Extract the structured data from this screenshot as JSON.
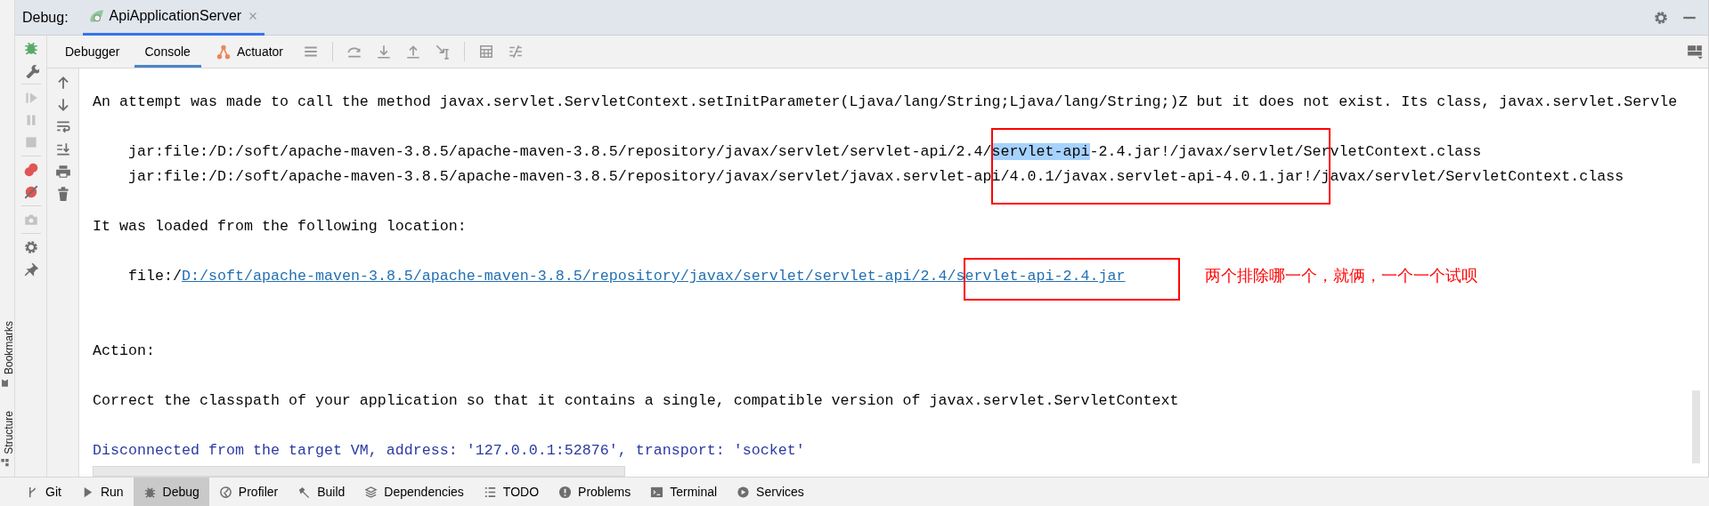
{
  "header": {
    "label": "Debug:",
    "tab": {
      "title": "ApiApplicationServer"
    }
  },
  "view_tabs": [
    {
      "label": "Debugger",
      "selected": false
    },
    {
      "label": "Console",
      "selected": true
    },
    {
      "label": "Actuator",
      "selected": false
    }
  ],
  "debug_toolbar": [
    {
      "disabled": false
    },
    {
      "disabled": false
    },
    {
      "disabled": true
    },
    {
      "disabled": true
    },
    {
      "disabled": true
    },
    {
      "disabled": false
    },
    {
      "disabled": false
    },
    {
      "disabled": true
    },
    {
      "disabled": false
    },
    {
      "disabled": false
    }
  ],
  "side_tabs": [
    {
      "label": "Bookmarks"
    },
    {
      "label": "Structure"
    }
  ],
  "console": {
    "lines": [
      {
        "kind": "text",
        "segments": [
          {
            "text": "An attempt was made to call the method javax.servlet.ServletContext.setInitParameter(Ljava/lang/String;Ljava/lang/String;)Z but it does not exist. Its class, javax.servlet.Servle",
            "selected": false
          }
        ]
      },
      {
        "kind": "blank"
      },
      {
        "kind": "indented",
        "segments": [
          {
            "text": "jar:file:/D:/soft/apache-maven-3.8.5/apache-maven-3.8.5/repository/javax/servlet/servlet-api/2.4/",
            "selected": false
          },
          {
            "text": "servlet-api",
            "selected": true
          },
          {
            "text": "-2.4.jar!/javax/servlet/ServletContext.class",
            "selected": false
          }
        ]
      },
      {
        "kind": "indented",
        "segments": [
          {
            "text": "jar:file:/D:/soft/apache-maven-3.8.5/apache-maven-3.8.5/repository/javax/servlet/javax.servlet-api/4.0.1/javax.servlet-api-4.0.1.jar!/javax/servlet/ServletContext.class",
            "selected": false
          }
        ]
      },
      {
        "kind": "blank"
      },
      {
        "kind": "text",
        "segments": [
          {
            "text": "It was loaded from the following location:",
            "selected": false
          }
        ]
      },
      {
        "kind": "blank"
      },
      {
        "kind": "location",
        "prefix": "file:/",
        "link": "D:/soft/apache-maven-3.8.5/apache-maven-3.8.5/repository/javax/servlet/servlet-api/2.4/servlet-api-2.4.jar"
      },
      {
        "kind": "blank"
      },
      {
        "kind": "blank"
      },
      {
        "kind": "text",
        "segments": [
          {
            "text": "Action:",
            "selected": false
          }
        ]
      },
      {
        "kind": "blank"
      },
      {
        "kind": "text",
        "segments": [
          {
            "text": "Correct the classpath of your application so that it contains a single, compatible version of javax.servlet.ServletContext",
            "selected": false
          }
        ]
      },
      {
        "kind": "blank"
      },
      {
        "kind": "system",
        "segments": [
          {
            "text": "Disconnected from the target VM, address: '127.0.0.1:52876', transport: 'socket'",
            "selected": false
          }
        ]
      }
    ],
    "annotations": [
      {
        "kind": "box",
        "color": "#ff0000"
      },
      {
        "kind": "box",
        "color": "#ff0000"
      },
      {
        "kind": "note",
        "color": "#ff0000",
        "text": "两个排除哪一个，就俩，一个一个试呗"
      }
    ]
  },
  "bottom_tabs": [
    {
      "label": "Git",
      "selected": false
    },
    {
      "label": "Run",
      "selected": false
    },
    {
      "label": "Debug",
      "selected": true
    },
    {
      "label": "Profiler",
      "selected": false
    },
    {
      "label": "Build",
      "selected": false
    },
    {
      "label": "Dependencies",
      "selected": false
    },
    {
      "label": "TODO",
      "selected": false
    },
    {
      "label": "Problems",
      "selected": false
    },
    {
      "label": "Terminal",
      "selected": false
    },
    {
      "label": "Services",
      "selected": false
    }
  ]
}
